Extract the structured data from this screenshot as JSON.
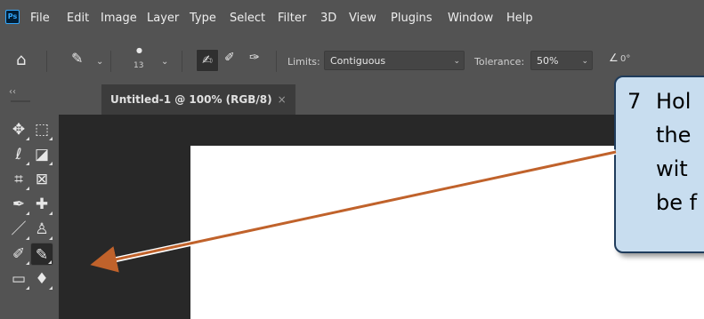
{
  "menubar": {
    "app_icon_label": "Ps",
    "items": [
      "File",
      "Edit",
      "Image",
      "Layer",
      "Type",
      "Select",
      "Filter",
      "3D",
      "View",
      "Plugins",
      "Window",
      "Help"
    ]
  },
  "options": {
    "brush_size": "13",
    "limits_label": "Limits:",
    "limits_value": "Contiguous",
    "tolerance_label": "Tolerance:",
    "tolerance_value": "50%",
    "angle_value": "0°"
  },
  "toolbar": {
    "collapse_label": "‹‹"
  },
  "document": {
    "tab_title": "Untitled-1 @ 100% (RGB/8)",
    "tab_close": "×"
  },
  "callout": {
    "number": "7",
    "lines": [
      "Hol",
      "the",
      "wit",
      "be f"
    ]
  },
  "colors": {
    "arrow": "#c0622b",
    "callout_bg": "#c8ddef",
    "callout_border": "#1f3c5c"
  }
}
